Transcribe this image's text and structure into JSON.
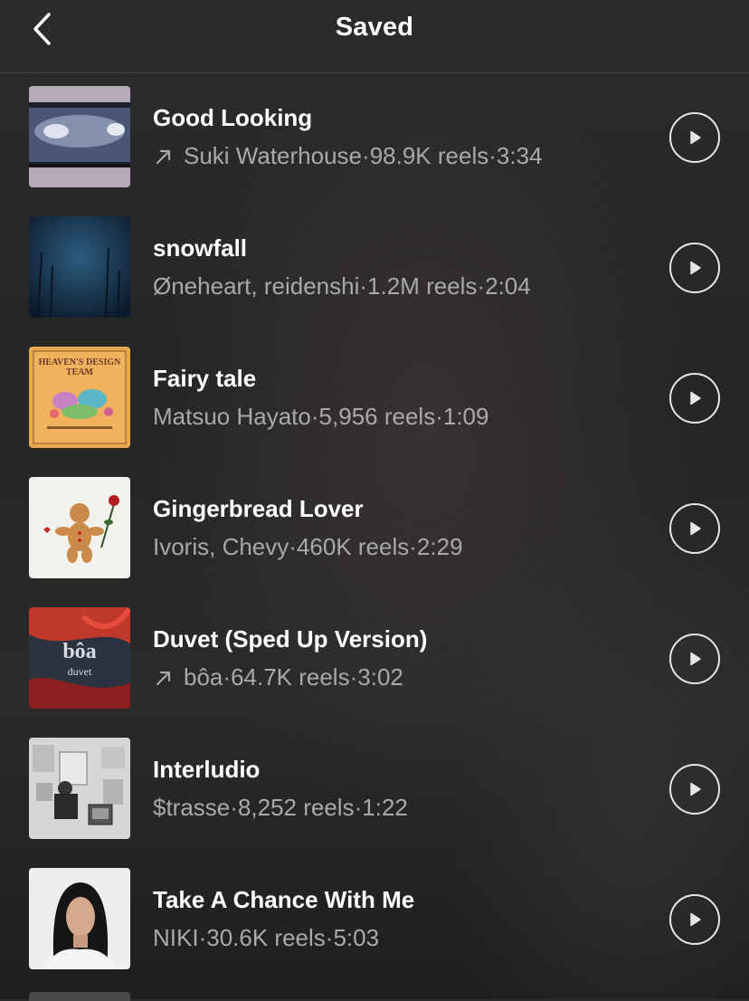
{
  "header": {
    "title": "Saved",
    "back_icon": "chevron-left-icon"
  },
  "songs": [
    {
      "title": "Good Looking",
      "trending": true,
      "artist": "Suki Waterhouse",
      "reels": "98.9K reels",
      "duration": "3:34"
    },
    {
      "title": "snowfall",
      "trending": false,
      "artist": "Øneheart, reidenshi",
      "reels": "1.2M reels",
      "duration": "2:04"
    },
    {
      "title": "Fairy tale",
      "trending": false,
      "artist": "Matsuo Hayato",
      "reels": "5,956 reels",
      "duration": "1:09",
      "art_text": "HEAVEN'S DESIGN TEAM"
    },
    {
      "title": "Gingerbread Lover",
      "trending": false,
      "artist": "Ivoris, Chevy",
      "reels": "460K reels",
      "duration": "2:29"
    },
    {
      "title": "Duvet (Sped Up Version)",
      "trending": true,
      "artist": "bôa",
      "reels": "64.7K reels",
      "duration": "3:02",
      "art_text": "bôa",
      "art_subtext": "duvet"
    },
    {
      "title": "Interludio",
      "trending": false,
      "artist": "$trasse",
      "reels": "8,252 reels",
      "duration": "1:22"
    },
    {
      "title": "Take A Chance With Me",
      "trending": false,
      "artist": "NIKI",
      "reels": "30.6K reels",
      "duration": "5:03"
    }
  ],
  "separator": " · ",
  "colors": {
    "text": "#ffffff",
    "meta": "#a9a9aa",
    "background": "#262626"
  }
}
